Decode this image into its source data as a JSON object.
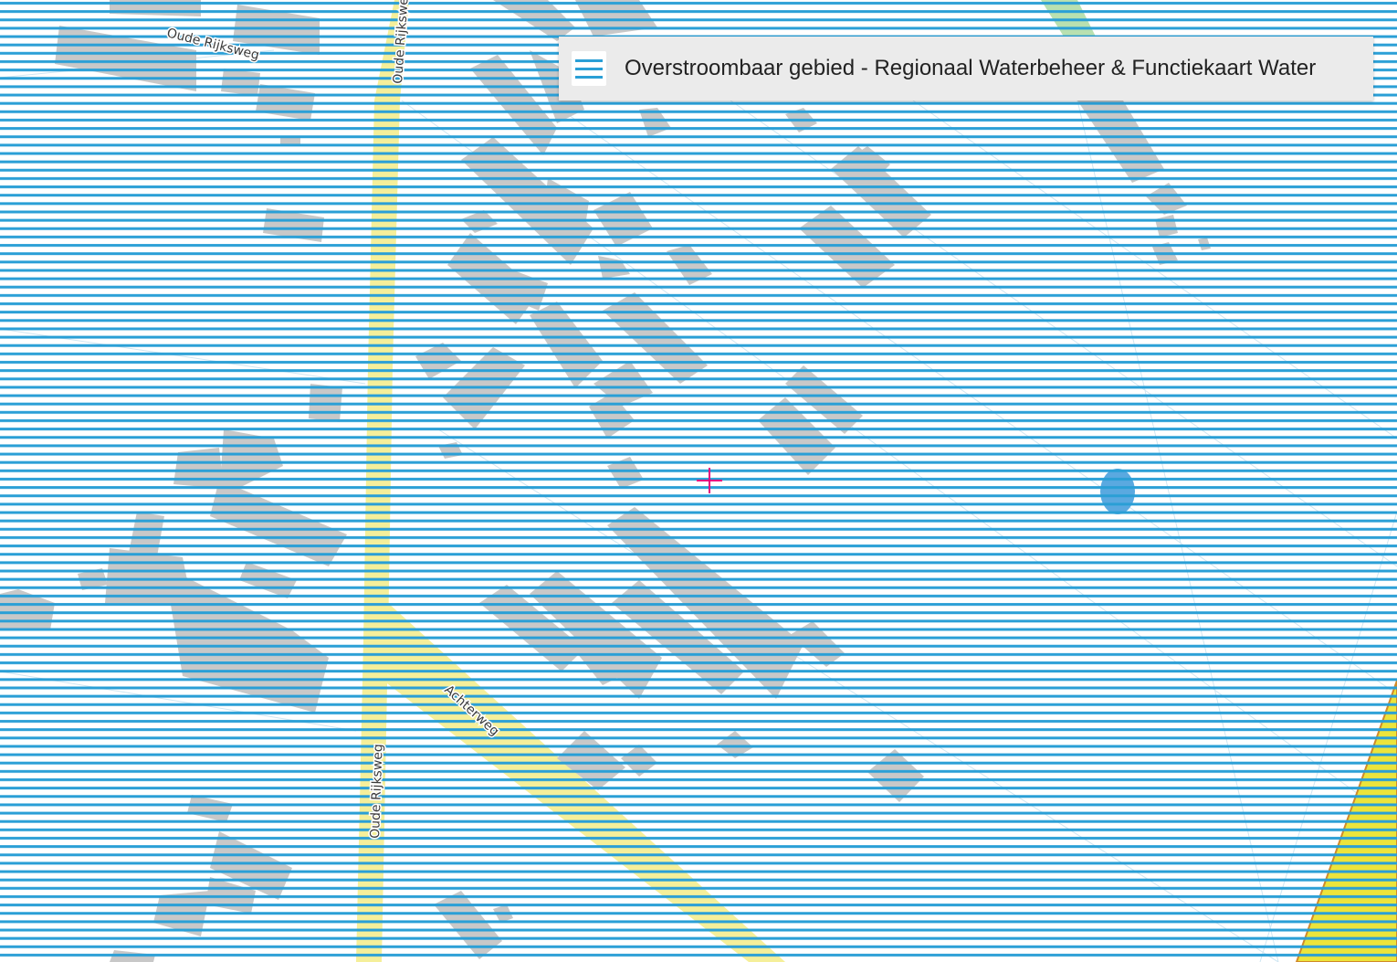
{
  "layer_panel": {
    "title": "Overstroombaar gebied - Regionaal Waterbeheer & Functiekaart Water",
    "menu_icon": "hamburger-menu-icon"
  },
  "map": {
    "road_labels": [
      "Oude Rijksweg",
      "Oude Rijksweg",
      "Oude Rijksweg",
      "Achterweg"
    ],
    "crosshair_icon": "crosshair-icon"
  },
  "colors": {
    "hatch_blue": "#2a9fd6",
    "building_grey": "#c8c8c8",
    "road_yellow": "#f5ef9a",
    "zone_yellow": "#ece43b",
    "pond_blue": "#5aa9e0",
    "crosshair_magenta": "#e6007e",
    "panel_bg": "#ebebeb"
  }
}
